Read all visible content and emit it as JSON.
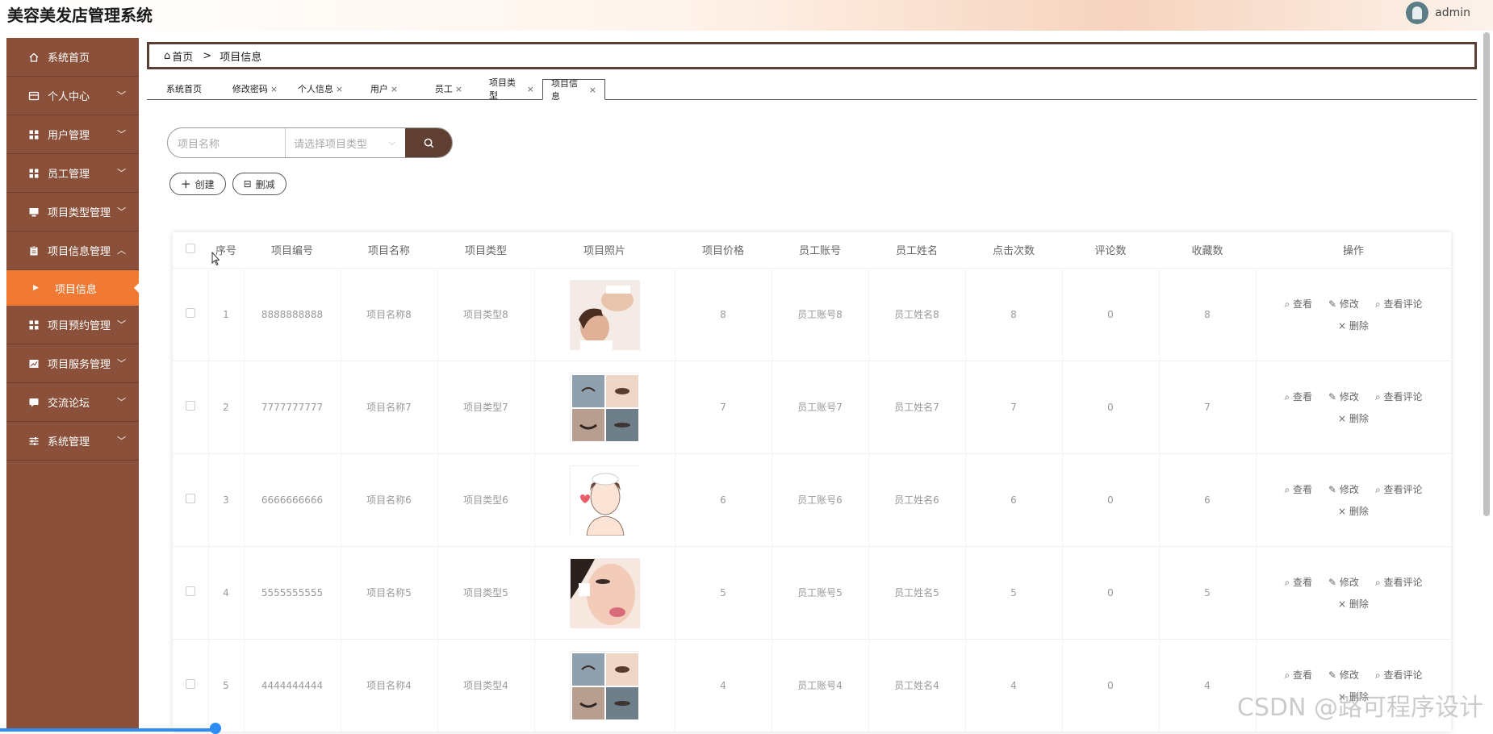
{
  "app": {
    "title": "美容美发店管理系统",
    "user_name": "admin"
  },
  "sidebar": {
    "items": [
      {
        "label": "系统首页",
        "icon": "home-icon",
        "expandable": false
      },
      {
        "label": "个人中心",
        "icon": "card-icon",
        "expandable": true,
        "expanded": false
      },
      {
        "label": "用户管理",
        "icon": "grid-icon",
        "expandable": true,
        "expanded": false
      },
      {
        "label": "员工管理",
        "icon": "grid-icon",
        "expandable": true,
        "expanded": false
      },
      {
        "label": "项目类型管理",
        "icon": "monitor-icon",
        "expandable": true,
        "expanded": false
      },
      {
        "label": "项目信息管理",
        "icon": "clipboard-icon",
        "expandable": true,
        "expanded": true
      },
      {
        "label": "项目预约管理",
        "icon": "grid-icon",
        "expandable": true,
        "expanded": false
      },
      {
        "label": "项目服务管理",
        "icon": "chart-icon",
        "expandable": true,
        "expanded": false
      },
      {
        "label": "交流论坛",
        "icon": "chat-icon",
        "expandable": true,
        "expanded": false
      },
      {
        "label": "系统管理",
        "icon": "sliders-icon",
        "expandable": true,
        "expanded": false
      }
    ],
    "active_sub": "项目信息"
  },
  "breadcrumb": {
    "home": "首页",
    "separator": ">",
    "current": "项目信息"
  },
  "tabs": [
    {
      "label": "系统首页",
      "closable": false,
      "active": false
    },
    {
      "label": "修改密码",
      "closable": true,
      "active": false
    },
    {
      "label": "个人信息",
      "closable": true,
      "active": false
    },
    {
      "label": "用户",
      "closable": true,
      "active": false
    },
    {
      "label": "员工",
      "closable": true,
      "active": false
    },
    {
      "label": "项目类型",
      "closable": true,
      "active": false
    },
    {
      "label": "项目信息",
      "closable": true,
      "active": true
    }
  ],
  "search": {
    "name_placeholder": "项目名称",
    "type_placeholder": "请选择项目类型"
  },
  "toolbar": {
    "create_label": "创建",
    "delete_label": "删减"
  },
  "table": {
    "columns": [
      "序号",
      "项目编号",
      "项目名称",
      "项目类型",
      "项目照片",
      "项目价格",
      "员工账号",
      "员工姓名",
      "点击次数",
      "评论数",
      "收藏数",
      "操作"
    ],
    "rows": [
      {
        "index": "1",
        "code": "8888888888",
        "name": "项目名称8",
        "type": "项目类型8",
        "photo": "face-massage",
        "price": "8",
        "staff_account": "员工账号8",
        "staff_name": "员工姓名8",
        "clicks": "8",
        "comments": "0",
        "favorites": "8"
      },
      {
        "index": "2",
        "code": "7777777777",
        "name": "项目名称7",
        "type": "项目类型7",
        "photo": "eyes-collage",
        "price": "7",
        "staff_account": "员工账号7",
        "staff_name": "员工姓名7",
        "clicks": "7",
        "comments": "0",
        "favorites": "7"
      },
      {
        "index": "3",
        "code": "6666666666",
        "name": "项目名称6",
        "type": "项目类型6",
        "photo": "illustrated-face",
        "price": "6",
        "staff_account": "员工账号6",
        "staff_name": "员工姓名6",
        "clicks": "6",
        "comments": "0",
        "favorites": "6"
      },
      {
        "index": "4",
        "code": "5555555555",
        "name": "项目名称5",
        "type": "项目类型5",
        "photo": "makeup-face",
        "price": "5",
        "staff_account": "员工账号5",
        "staff_name": "员工姓名5",
        "clicks": "5",
        "comments": "0",
        "favorites": "5"
      },
      {
        "index": "5",
        "code": "4444444444",
        "name": "项目名称4",
        "type": "项目类型4",
        "photo": "eyes-collage",
        "price": "4",
        "staff_account": "员工账号4",
        "staff_name": "员工姓名4",
        "clicks": "4",
        "comments": "0",
        "favorites": "4"
      }
    ],
    "ops": {
      "view": "查看",
      "edit": "修改",
      "view_comments": "查看评论",
      "delete": "删除"
    }
  },
  "watermark": "CSDN @路可程序设计",
  "colors": {
    "sidebar": "#8a5039",
    "sidebar_active": "#f07a34",
    "search_button": "#603f33",
    "progress": "#2f8cf2"
  }
}
